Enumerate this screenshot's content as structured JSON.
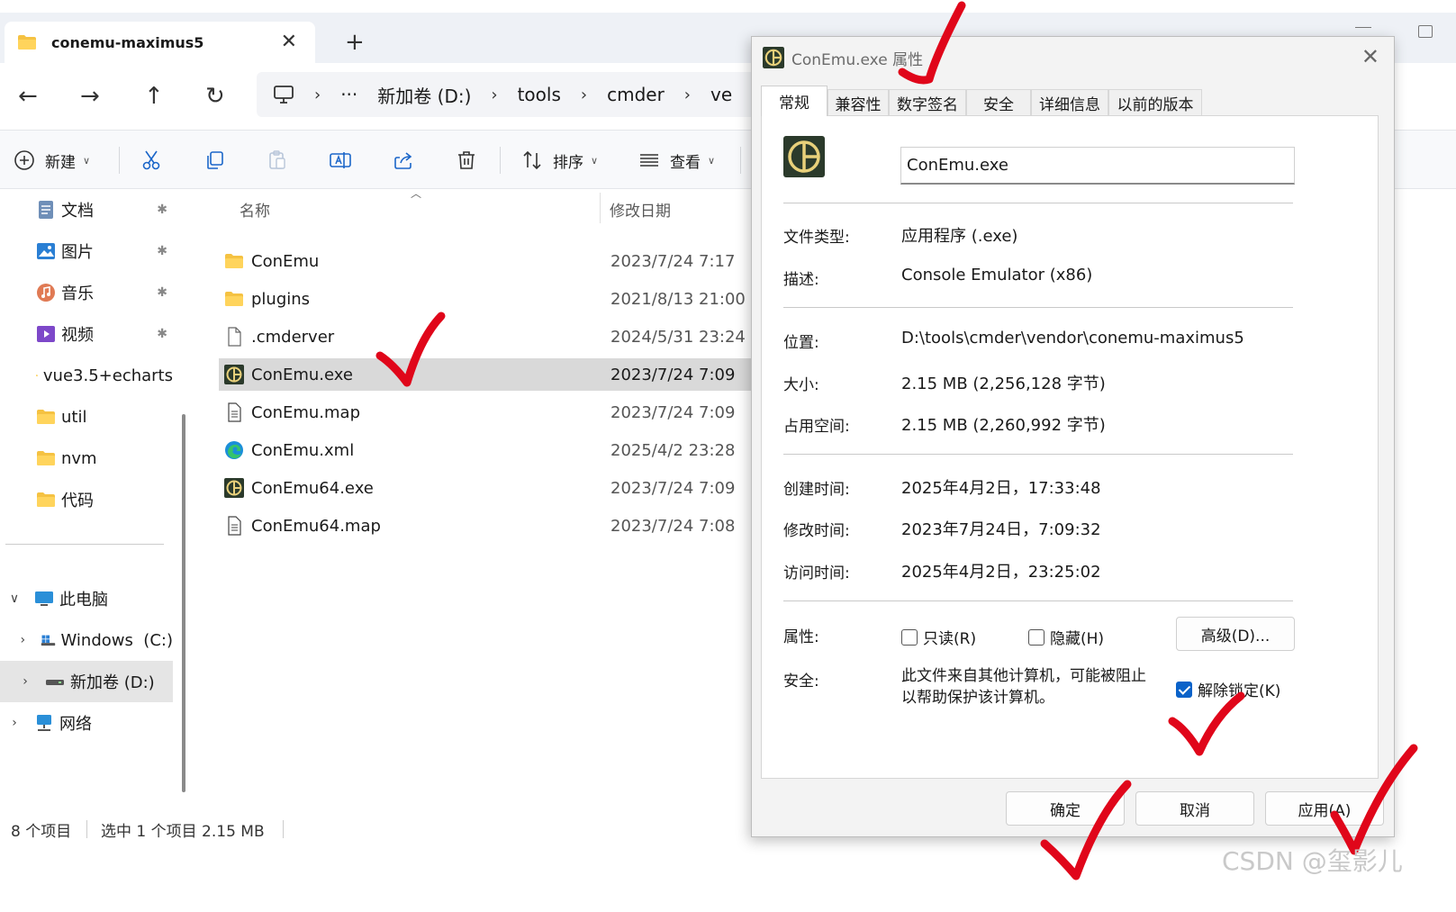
{
  "explorer": {
    "tab_title": "conemu-maximus5",
    "tab_close_glyph": "✕",
    "new_tab_glyph": "+",
    "nav": {
      "back_glyph": "←",
      "forward_glyph": "→",
      "up_glyph": "↑",
      "refresh_glyph": "↻"
    },
    "breadcrumb": {
      "sep": "›",
      "more": "···",
      "items": [
        "新加卷 (D:)",
        "tools",
        "cmder",
        "ve"
      ]
    },
    "toolbar": {
      "new_label": "新建",
      "sort_label": "排序",
      "view_label": "查看"
    },
    "sidebar": {
      "quick": [
        {
          "label": "文档",
          "icon": "documents-icon",
          "color": "#6f8fb8",
          "pinned": true
        },
        {
          "label": "图片",
          "icon": "pictures-icon",
          "color": "#2a7fd4",
          "pinned": true
        },
        {
          "label": "音乐",
          "icon": "music-icon",
          "color": "#e07a54",
          "pinned": true
        },
        {
          "label": "视频",
          "icon": "videos-icon",
          "color": "#7d48c9",
          "pinned": true
        },
        {
          "label": "vue3.5+echarts",
          "icon": "folder-icon",
          "color": "#f5c242",
          "pinned": false
        },
        {
          "label": "util",
          "icon": "folder-icon",
          "color": "#f5c242",
          "pinned": false
        },
        {
          "label": "nvm",
          "icon": "folder-icon",
          "color": "#f5c242",
          "pinned": false
        },
        {
          "label": "代码",
          "icon": "folder-icon",
          "color": "#f5c242",
          "pinned": false
        }
      ],
      "pin_glyph": "📌",
      "tree": [
        {
          "label": "此电脑",
          "icon": "this-pc-icon",
          "twisty": "∨"
        },
        {
          "label": "Windows  (C:)",
          "icon": "drive-c-icon",
          "twisty": "›"
        },
        {
          "label": "新加卷 (D:)",
          "icon": "drive-d-icon",
          "twisty": "›"
        },
        {
          "label": "网络",
          "icon": "network-icon",
          "twisty": "›"
        }
      ]
    },
    "columns": {
      "name": "名称",
      "modified": "修改日期"
    },
    "files": [
      {
        "name": "ConEmu",
        "date": "2023/7/24 7:17",
        "icon": "folder-icon"
      },
      {
        "name": "plugins",
        "date": "2021/8/13 21:00",
        "icon": "folder-icon"
      },
      {
        "name": ".cmderver",
        "date": "2024/5/31 23:24",
        "icon": "file-icon"
      },
      {
        "name": "ConEmu.exe",
        "date": "2023/7/24 7:09",
        "icon": "conemu-icon"
      },
      {
        "name": "ConEmu.map",
        "date": "2023/7/24 7:09",
        "icon": "text-file-icon"
      },
      {
        "name": "ConEmu.xml",
        "date": "2025/4/2 23:28",
        "icon": "edge-icon"
      },
      {
        "name": "ConEmu64.exe",
        "date": "2023/7/24 7:09",
        "icon": "conemu-icon"
      },
      {
        "name": "ConEmu64.map",
        "date": "2023/7/24 7:08",
        "icon": "text-file-icon"
      }
    ],
    "status": {
      "count": "8 个项目",
      "selected": "选中 1 个项目  2.15 MB"
    }
  },
  "dialog": {
    "title": "ConEmu.exe 属性",
    "close_glyph": "✕",
    "tabs": [
      "常规",
      "兼容性",
      "数字签名",
      "安全",
      "详细信息",
      "以前的版本"
    ],
    "file_name": "ConEmu.exe",
    "props": {
      "type_label": "文件类型:",
      "type_value": "应用程序 (.exe)",
      "desc_label": "描述:",
      "desc_value": "Console Emulator (x86)",
      "loc_label": "位置:",
      "loc_value": "D:\\tools\\cmder\\vendor\\conemu-maximus5",
      "size_label": "大小:",
      "size_value": "2.15 MB (2,256,128 字节)",
      "disk_label": "占用空间:",
      "disk_value": "2.15 MB (2,260,992 字节)",
      "created_label": "创建时间:",
      "created_value": "2025年4月2日，17:33:48",
      "modified_label": "修改时间:",
      "modified_value": "2023年7月24日，7:09:32",
      "accessed_label": "访问时间:",
      "accessed_value": "2025年4月2日，23:25:02",
      "attr_label": "属性:",
      "readonly_label": "只读(R)",
      "hidden_label": "隐藏(H)",
      "advanced_label": "高级(D)...",
      "security_label": "安全:",
      "security_line1": "此文件来自其他计算机，可能被阻止",
      "security_line2": "以帮助保护该计算机。",
      "unblock_label": "解除锁定(K)",
      "readonly_checked": false,
      "hidden_checked": false,
      "unblock_checked": true
    },
    "buttons": {
      "ok": "确定",
      "cancel": "取消",
      "apply": "应用(A)"
    }
  },
  "watermark": "CSDN @玺影儿",
  "colors": {
    "accent": "#0a62c9",
    "folder": "#f5c242",
    "annotation": "#e0061a"
  }
}
